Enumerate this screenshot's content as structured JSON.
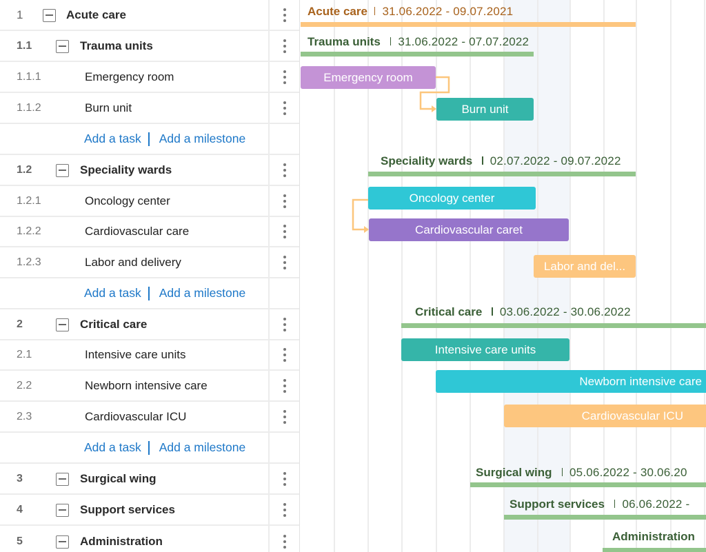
{
  "colors": {
    "orange_summary": "#fdc67f",
    "orange_text": "#a8621c",
    "green_summary": "#93c58c",
    "green_text": "#3a5f36",
    "purple_light": "#c493d6",
    "teal": "#35b5a9",
    "cyan": "#2fc7d6",
    "purple": "#9675cb",
    "orange_task": "#fdc67f",
    "link_blue": "#1e78c8",
    "weekend_bg": "#f3f6fa",
    "connector": "#fcc67c"
  },
  "grid": {
    "rows": [
      {
        "type": "group",
        "level": 0,
        "num": "1",
        "name": "Acute care",
        "collapsible": true
      },
      {
        "type": "group",
        "level": 1,
        "num": "1.1",
        "name": "Trauma units",
        "collapsible": true
      },
      {
        "type": "task",
        "num": "1.1.1",
        "name": "Emergency room"
      },
      {
        "type": "task",
        "num": "1.1.2",
        "name": "Burn unit"
      },
      {
        "type": "add",
        "add_task": "Add a task",
        "add_milestone": "Add a milestone"
      },
      {
        "type": "group",
        "level": 1,
        "num": "1.2",
        "name": "Speciality wards",
        "collapsible": true
      },
      {
        "type": "task",
        "num": "1.2.1",
        "name": "Oncology center"
      },
      {
        "type": "task",
        "num": "1.2.2",
        "name": "Cardiovascular care"
      },
      {
        "type": "task",
        "num": "1.2.3",
        "name": "Labor and delivery"
      },
      {
        "type": "add",
        "add_task": "Add a task",
        "add_milestone": "Add a milestone"
      },
      {
        "type": "group",
        "level": 1,
        "num": "2",
        "name": "Critical care",
        "collapsible": true
      },
      {
        "type": "task",
        "num": "2.1",
        "name": "Intensive care units"
      },
      {
        "type": "task",
        "num": "2.2",
        "name": "Newborn intensive care"
      },
      {
        "type": "task",
        "num": "2.3",
        "name": "Cardiovascular ICU"
      },
      {
        "type": "add",
        "add_task": "Add a task",
        "add_milestone": "Add a milestone"
      },
      {
        "type": "group",
        "level": 1,
        "num": "3",
        "name": "Surgical wing",
        "collapsible": true
      },
      {
        "type": "group",
        "level": 1,
        "num": "4",
        "name": "Support services",
        "collapsible": true
      },
      {
        "type": "group",
        "level": 1,
        "num": "5",
        "name": "Administration",
        "collapsible": true
      }
    ]
  },
  "chart": {
    "summaries": [
      {
        "title": "Acute care",
        "dates": "31.06.2022 - 09.07.2021",
        "color": "orange"
      },
      {
        "title": "Trauma units",
        "dates": "31.06.2022 - 07.07.2022",
        "color": "green"
      },
      {
        "title": "Speciality wards",
        "dates": "02.07.2022 - 09.07.2022",
        "color": "green"
      },
      {
        "title": "Critical care",
        "dates": "03.06.2022 - 30.06.2022",
        "color": "green"
      },
      {
        "title": "Surgical wing",
        "dates": "05.06.2022 - 30.06.20",
        "color": "green"
      },
      {
        "title": "Support services",
        "dates": "06.06.2022 -",
        "color": "green"
      },
      {
        "title": "Administration",
        "dates": "",
        "color": "green"
      }
    ],
    "tasks": [
      {
        "label": "Emergency room",
        "color": "purple_light"
      },
      {
        "label": "Burn unit",
        "color": "teal"
      },
      {
        "label": "Oncology center",
        "color": "cyan"
      },
      {
        "label": "Cardiovascular caret",
        "color": "purple"
      },
      {
        "label": "Labor and del...",
        "color": "orange_task"
      },
      {
        "label": "Intensive care units",
        "color": "teal"
      },
      {
        "label": "Newborn intensive care",
        "color": "cyan"
      },
      {
        "label": "Cardiovascular ICU",
        "color": "orange_task"
      }
    ]
  }
}
